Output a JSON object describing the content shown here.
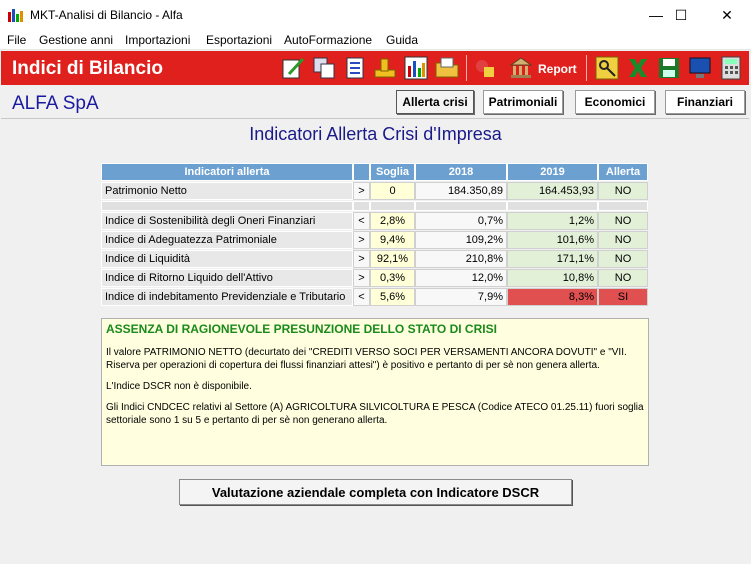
{
  "window": {
    "title": "MKT-Analisi di Bilancio  -  Alfa",
    "minimize": "—",
    "maximize": "☐",
    "close": "✕"
  },
  "menu": [
    "File",
    "Gestione anni",
    "Importazioni",
    "Esportazioni",
    "AutoFormazione",
    "Guida"
  ],
  "header": {
    "app_title": "Indici di Bilancio",
    "report_label": "Report",
    "accent": "#e0201c"
  },
  "toolbar_icons": [
    "edit-icon",
    "copy-icon",
    "list-icon",
    "ruler-icon",
    "bar-chart-icon",
    "folder-icon",
    "shapes-icon",
    "bank-icon",
    "key-icon",
    "excel-icon",
    "save-icon",
    "monitor-icon",
    "calculator-icon"
  ],
  "company": "ALFA SpA",
  "tabs": [
    "Allerta crisi",
    "Patrimoniali",
    "Economici",
    "Finanziari"
  ],
  "section_title": "Indicatori Allerta Crisi d'Impresa",
  "table": {
    "headers": [
      "Indicatori allerta",
      "",
      "Soglia",
      "2018",
      "2019",
      "Allerta"
    ],
    "rows": [
      {
        "label": "Patrimonio Netto",
        "dir": ">",
        "soglia": "0",
        "y2018": "184.350,89",
        "y2019": "164.453,93",
        "allerta": "NO",
        "bad": false
      },
      {
        "label": "Indice di Sostenibilità degli Oneri Finanziari",
        "dir": "<",
        "soglia": "2,8%",
        "y2018": "0,7%",
        "y2019": "1,2%",
        "allerta": "NO",
        "bad": false
      },
      {
        "label": "Indice di Adeguatezza Patrimoniale",
        "dir": ">",
        "soglia": "9,4%",
        "y2018": "109,2%",
        "y2019": "101,6%",
        "allerta": "NO",
        "bad": false
      },
      {
        "label": "Indice di Liquidità",
        "dir": ">",
        "soglia": "92,1%",
        "y2018": "210,8%",
        "y2019": "171,1%",
        "allerta": "NO",
        "bad": false
      },
      {
        "label": "Indice di Ritorno Liquido dell'Attivo",
        "dir": ">",
        "soglia": "0,3%",
        "y2018": "12,0%",
        "y2019": "10,8%",
        "allerta": "NO",
        "bad": false
      },
      {
        "label": "Indice di indebitamento Previdenziale e Tributario",
        "dir": "<",
        "soglia": "5,6%",
        "y2018": "7,9%",
        "y2019": "8,3%",
        "allerta": "SI",
        "bad": true
      }
    ]
  },
  "message": {
    "heading": "ASSENZA DI RAGIONEVOLE PRESUNZIONE DELLO STATO DI CRISI",
    "p1": "Il valore PATRIMONIO NETTO (decurtato dei \"CREDITI VERSO SOCI PER VERSAMENTI ANCORA DOVUTI\" e \"VII. Riserva per operazioni di copertura dei flussi finanziari attesi\") è positivo e pertanto di per sè non genera allerta.",
    "p2": "L'Indice DSCR non è disponibile.",
    "p3": "Gli Indici CNDCEC relativi al Settore (A) AGRICOLTURA SILVICOLTURA E PESCA (Codice ATECO 01.25.11) fuori soglia settoriale sono 1 su 5 e pertanto di per sè non generano allerta."
  },
  "dscr_button": "Valutazione aziendale completa con Indicatore DSCR"
}
